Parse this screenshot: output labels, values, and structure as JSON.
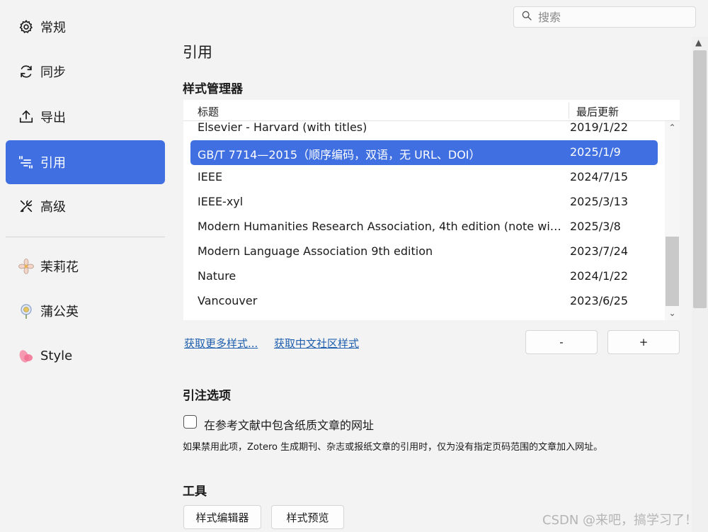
{
  "search": {
    "placeholder": "搜索"
  },
  "sidebar": {
    "items": [
      {
        "label": "常规",
        "icon": "gear-icon"
      },
      {
        "label": "同步",
        "icon": "sync-icon"
      },
      {
        "label": "导出",
        "icon": "export-icon"
      },
      {
        "label": "引用",
        "icon": "quote-icon",
        "active": true
      },
      {
        "label": "高级",
        "icon": "tools-icon"
      },
      {
        "label": "茉莉花",
        "icon": "jasmine-icon"
      },
      {
        "label": "蒲公英",
        "icon": "dandelion-icon"
      },
      {
        "label": "Style",
        "icon": "style-icon"
      }
    ]
  },
  "main": {
    "page_title": "引用",
    "style_manager": {
      "title": "样式管理器",
      "columns": [
        "标题",
        "最后更新"
      ],
      "rows": [
        {
          "title": "Elsevier - Harvard (with titles)",
          "date": "2019/1/22"
        },
        {
          "title": "GB/T 7714—2015（顺序编码，双语，无 URL、DOI）",
          "date": "2025/1/9",
          "selected": true
        },
        {
          "title": "IEEE",
          "date": "2024/7/15"
        },
        {
          "title": "IEEE-xyl",
          "date": "2025/3/13"
        },
        {
          "title": "Modern Humanities Research Association, 4th edition (note with...",
          "date": "2025/3/8"
        },
        {
          "title": "Modern Language Association 9th edition",
          "date": "2023/7/24"
        },
        {
          "title": "Nature",
          "date": "2024/1/22"
        },
        {
          "title": "Vancouver",
          "date": "2023/6/25"
        }
      ],
      "link_more": "获取更多样式...",
      "link_cn": "获取中文社区样式",
      "remove_label": "-",
      "add_label": "+"
    },
    "citation_options": {
      "title": "引注选项",
      "checkbox_label": "在参考文献中包含纸质文章的网址",
      "checked": false,
      "hint": "如果禁用此项，Zotero 生成期刊、杂志或报纸文章的引用时，仅为没有指定页码范围的文章加入网址。"
    },
    "tools": {
      "title": "工具",
      "editor_label": "样式编辑器",
      "preview_label": "样式预览"
    }
  },
  "watermark": "CSDN @来吧，搞学习了！",
  "colors": {
    "accent": "#3f6fe0",
    "link": "#1f5fae",
    "background": "#f3f3f3"
  }
}
